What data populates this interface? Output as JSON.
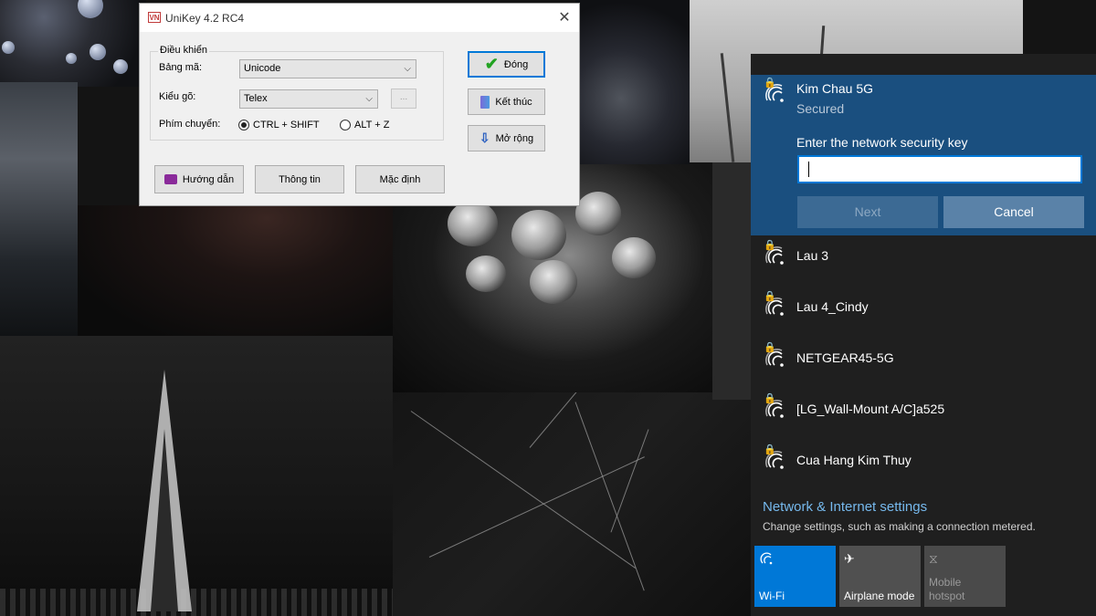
{
  "unikey": {
    "title": "UniKey 4.2 RC4",
    "app_icon_text": "VN",
    "close_glyph": "✕",
    "group_label": "Điều khiển",
    "charset_label": "Bảng mã:",
    "charset_value": "Unicode",
    "input_label": "Kiểu gõ:",
    "input_value": "Telex",
    "dots_button": "...",
    "switch_label": "Phím chuyển:",
    "switch_option_1": "CTRL + SHIFT",
    "switch_option_2": "ALT + Z",
    "close_button": "Đóng",
    "exit_button": "Kết thúc",
    "expand_button": "Mở rộng",
    "help_button": "Hướng dẫn",
    "info_button": "Thông tin",
    "default_button": "Mặc định"
  },
  "wifi": {
    "active": {
      "name": "Kim Chau 5G",
      "status": "Secured",
      "key_prompt": "Enter the network security key",
      "key_value": "",
      "next_button": "Next",
      "cancel_button": "Cancel"
    },
    "networks": [
      {
        "name": "Lau 3"
      },
      {
        "name": "Lau 4_Cindy"
      },
      {
        "name": "NETGEAR45-5G"
      },
      {
        "name": "[LG_Wall-Mount A/C]a525"
      },
      {
        "name": "Cua Hang Kim Thuy"
      }
    ],
    "settings_link": "Network & Internet settings",
    "settings_sub": "Change settings, such as making a connection metered.",
    "quick_actions": [
      {
        "label": "Wi-Fi",
        "icon": "wifi-icon",
        "state": "on"
      },
      {
        "label": "Airplane mode",
        "icon": "airplane-icon",
        "state": "off"
      },
      {
        "label": "Mobile hotspot",
        "icon": "hotspot-icon",
        "state": "disabled"
      }
    ]
  },
  "colors": {
    "accent": "#0078d7",
    "active_network_bg": "#1a4f7f",
    "flyout_bg": "#1f1f1f",
    "link": "#76b9ed"
  }
}
